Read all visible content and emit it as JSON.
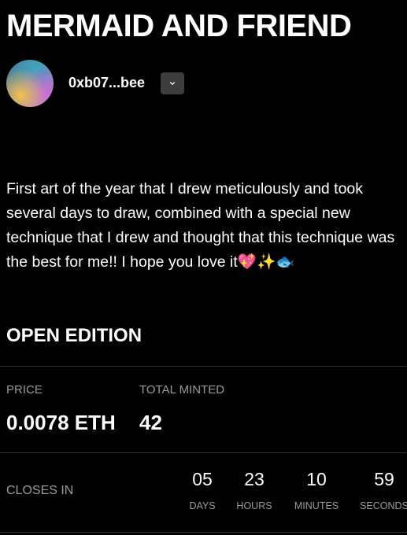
{
  "title": "MERMAID AND FRIEND",
  "creator": {
    "address": "0xb07...bee",
    "dropdown_icon": "chevron-down-icon"
  },
  "description": "First art of the year that I drew meticulously and took several days to draw, combined with a special new technique that I drew and thought that this technique was the best for me!! I hope you love it💖✨🐟",
  "edition": {
    "title": "OPEN EDITION",
    "price_label": "PRICE",
    "price_value": "0.0078 ETH",
    "minted_label": "TOTAL MINTED",
    "minted_value": "42"
  },
  "countdown": {
    "label": "CLOSES IN",
    "units": [
      {
        "value": "05",
        "label": "DAYS"
      },
      {
        "value": "23",
        "label": "HOURS"
      },
      {
        "value": "10",
        "label": "MINUTES"
      },
      {
        "value": "59",
        "label": "SECONDS"
      }
    ]
  },
  "colors": {
    "background": "#000000",
    "text": "#ffffff",
    "muted": "#9a9a9a",
    "divider": "#333333",
    "dropdown_bg": "#3d3d3d"
  }
}
